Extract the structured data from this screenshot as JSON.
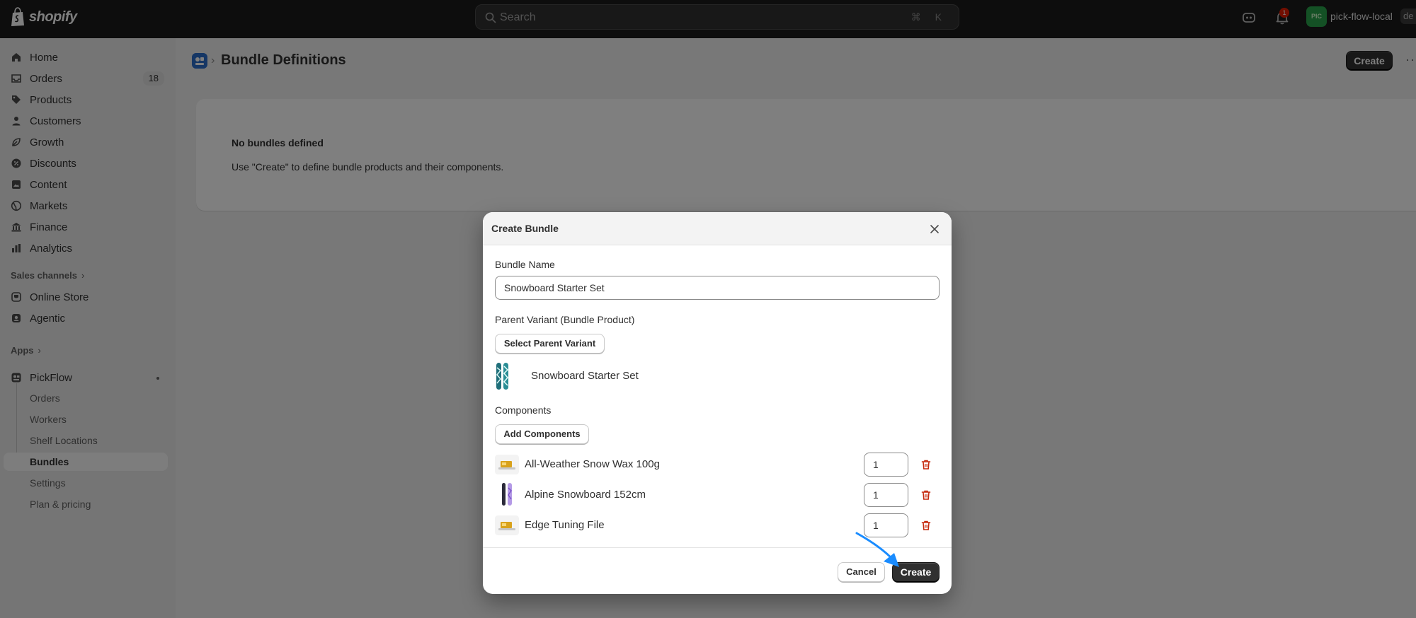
{
  "brand": {
    "name": "shopify"
  },
  "search": {
    "placeholder": "Search",
    "shortcut": "⌘ K"
  },
  "topbar": {
    "notification_count": "1",
    "store_avatar": "PIC",
    "store_name": "pick-flow-local",
    "store_chip": "de"
  },
  "sidebar": {
    "items": [
      {
        "label": "Home",
        "icon": "home-icon"
      },
      {
        "label": "Orders",
        "icon": "inbox-icon",
        "badge": "18"
      },
      {
        "label": "Products",
        "icon": "tag-icon"
      },
      {
        "label": "Customers",
        "icon": "person-icon"
      },
      {
        "label": "Growth",
        "icon": "growth-icon"
      },
      {
        "label": "Discounts",
        "icon": "discount-icon"
      },
      {
        "label": "Content",
        "icon": "content-icon"
      },
      {
        "label": "Markets",
        "icon": "globe-icon"
      },
      {
        "label": "Finance",
        "icon": "bank-icon"
      },
      {
        "label": "Analytics",
        "icon": "chart-icon"
      }
    ],
    "sales_channels_label": "Sales channels",
    "channels": [
      {
        "label": "Online Store",
        "icon": "store-icon"
      },
      {
        "label": "Agentic",
        "icon": "agentic-icon"
      }
    ],
    "apps_label": "Apps",
    "app": {
      "label": "PickFlow",
      "icon": "app-icon"
    },
    "app_items": [
      {
        "label": "Orders"
      },
      {
        "label": "Workers"
      },
      {
        "label": "Shelf Locations"
      },
      {
        "label": "Bundles",
        "active": true
      },
      {
        "label": "Settings"
      },
      {
        "label": "Plan & pricing"
      }
    ]
  },
  "page": {
    "title": "Bundle Definitions",
    "create_label": "Create",
    "empty_title": "No bundles defined",
    "empty_description": "Use \"Create\" to define bundle products and their components."
  },
  "modal": {
    "title": "Create Bundle",
    "bundle_name_label": "Bundle Name",
    "bundle_name_value": "Snowboard Starter Set",
    "parent_label": "Parent Variant (Bundle Product)",
    "select_parent_label": "Select Parent Variant",
    "parent_selected": "Snowboard Starter Set",
    "components_label": "Components",
    "add_components_label": "Add Components",
    "components": [
      {
        "name": "All-Weather Snow Wax 100g",
        "qty": "1"
      },
      {
        "name": "Alpine Snowboard 152cm",
        "qty": "1"
      },
      {
        "name": "Edge Tuning File",
        "qty": "1"
      }
    ],
    "cancel_label": "Cancel",
    "create_label": "Create"
  },
  "colors": {
    "primary": "#303030",
    "accent_blue": "#2c6ecb",
    "danger": "#c5280c",
    "pointer": "#1a8cff"
  }
}
